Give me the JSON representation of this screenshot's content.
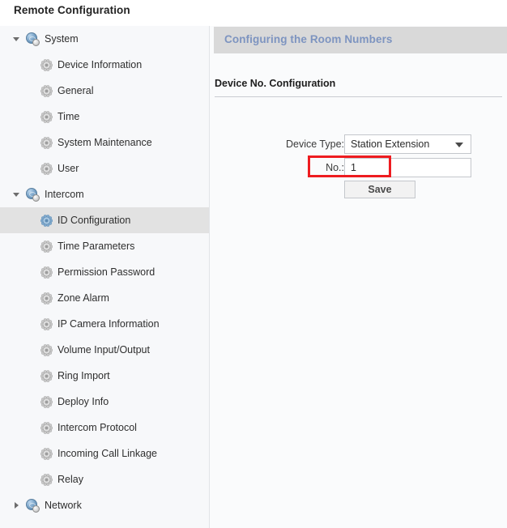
{
  "window": {
    "title": "Remote Configuration"
  },
  "sidebar": {
    "items": [
      {
        "label": "System",
        "level": 1,
        "icon": "globe-icon",
        "twisty": "expanded",
        "selected": false
      },
      {
        "label": "Device Information",
        "level": 2,
        "icon": "gear-icon",
        "twisty": "none",
        "selected": false
      },
      {
        "label": "General",
        "level": 2,
        "icon": "gear-icon",
        "twisty": "none",
        "selected": false
      },
      {
        "label": "Time",
        "level": 2,
        "icon": "gear-icon",
        "twisty": "none",
        "selected": false
      },
      {
        "label": "System Maintenance",
        "level": 2,
        "icon": "gear-icon",
        "twisty": "none",
        "selected": false
      },
      {
        "label": "User",
        "level": 2,
        "icon": "gear-icon",
        "twisty": "none",
        "selected": false
      },
      {
        "label": "Intercom",
        "level": 1,
        "icon": "globe-icon",
        "twisty": "expanded",
        "selected": false
      },
      {
        "label": "ID Configuration",
        "level": 2,
        "icon": "gear-icon",
        "twisty": "none",
        "selected": true
      },
      {
        "label": "Time Parameters",
        "level": 2,
        "icon": "gear-icon",
        "twisty": "none",
        "selected": false
      },
      {
        "label": "Permission Password",
        "level": 2,
        "icon": "gear-icon",
        "twisty": "none",
        "selected": false
      },
      {
        "label": "Zone Alarm",
        "level": 2,
        "icon": "gear-icon",
        "twisty": "none",
        "selected": false
      },
      {
        "label": "IP Camera Information",
        "level": 2,
        "icon": "gear-icon",
        "twisty": "none",
        "selected": false
      },
      {
        "label": "Volume Input/Output",
        "level": 2,
        "icon": "gear-icon",
        "twisty": "none",
        "selected": false
      },
      {
        "label": "Ring Import",
        "level": 2,
        "icon": "gear-icon",
        "twisty": "none",
        "selected": false
      },
      {
        "label": "Deploy Info",
        "level": 2,
        "icon": "gear-icon",
        "twisty": "none",
        "selected": false
      },
      {
        "label": "Intercom Protocol",
        "level": 2,
        "icon": "gear-icon",
        "twisty": "none",
        "selected": false
      },
      {
        "label": "Incoming Call Linkage",
        "level": 2,
        "icon": "gear-icon",
        "twisty": "none",
        "selected": false
      },
      {
        "label": "Relay",
        "level": 2,
        "icon": "gear-icon",
        "twisty": "none",
        "selected": false
      },
      {
        "label": "Network",
        "level": 1,
        "icon": "globe-icon",
        "twisty": "collapsed",
        "selected": false
      }
    ]
  },
  "content": {
    "banner_title": "Configuring the Room Numbers",
    "group_title": "Device No. Configuration",
    "fields": {
      "device_type": {
        "label": "Device Type:",
        "value": "Station Extension",
        "options": [
          "Station Extension"
        ]
      },
      "number": {
        "label": "No.:",
        "value": "1",
        "placeholder": ""
      }
    },
    "save_label": "Save"
  },
  "annotation": {
    "color": "#ee1c20",
    "target": "no-field-row"
  }
}
